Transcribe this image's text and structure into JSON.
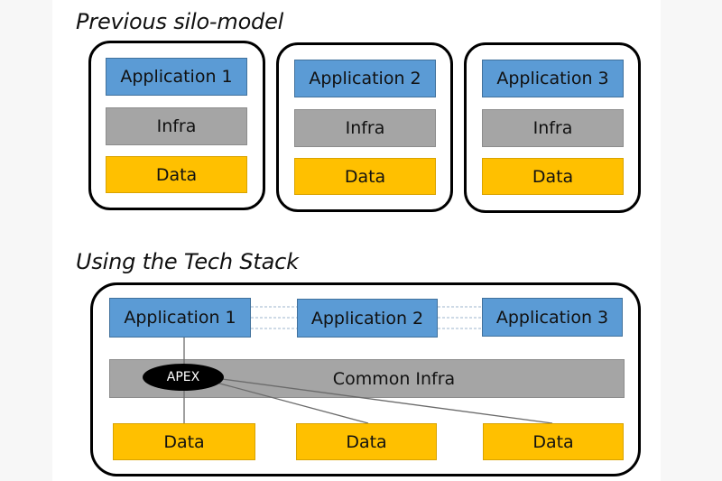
{
  "background_color": "#ffffff",
  "colors": {
    "application": "#5b9bd5",
    "infra": "#a5a5a5",
    "data": "#ffc000",
    "apex": "#000000",
    "outline": "#000000"
  },
  "silo_section": {
    "title": "Previous silo-model",
    "silos": [
      {
        "application": "Application 1",
        "infra": "Infra",
        "data": "Data"
      },
      {
        "application": "Application 2",
        "infra": "Infra",
        "data": "Data"
      },
      {
        "application": "Application 3",
        "infra": "Infra",
        "data": "Data"
      }
    ]
  },
  "stack_section": {
    "title": "Using the Tech Stack",
    "applications": [
      "Application 1",
      "Application 2",
      "Application 3"
    ],
    "common_infra": "Common Infra",
    "apex_label": "APEX",
    "data": [
      "Data",
      "Data",
      "Data"
    ],
    "connections": [
      {
        "from": "Application 1",
        "to": "Application 2",
        "style": "dashed"
      },
      {
        "from": "Application 2",
        "to": "Application 3",
        "style": "dashed"
      },
      {
        "from": "Application 1",
        "to": "APEX",
        "style": "solid"
      },
      {
        "from": "APEX",
        "to": "Data 1",
        "style": "solid"
      },
      {
        "from": "APEX",
        "to": "Data 2",
        "style": "solid"
      },
      {
        "from": "APEX",
        "to": "Data 3",
        "style": "solid"
      }
    ]
  }
}
